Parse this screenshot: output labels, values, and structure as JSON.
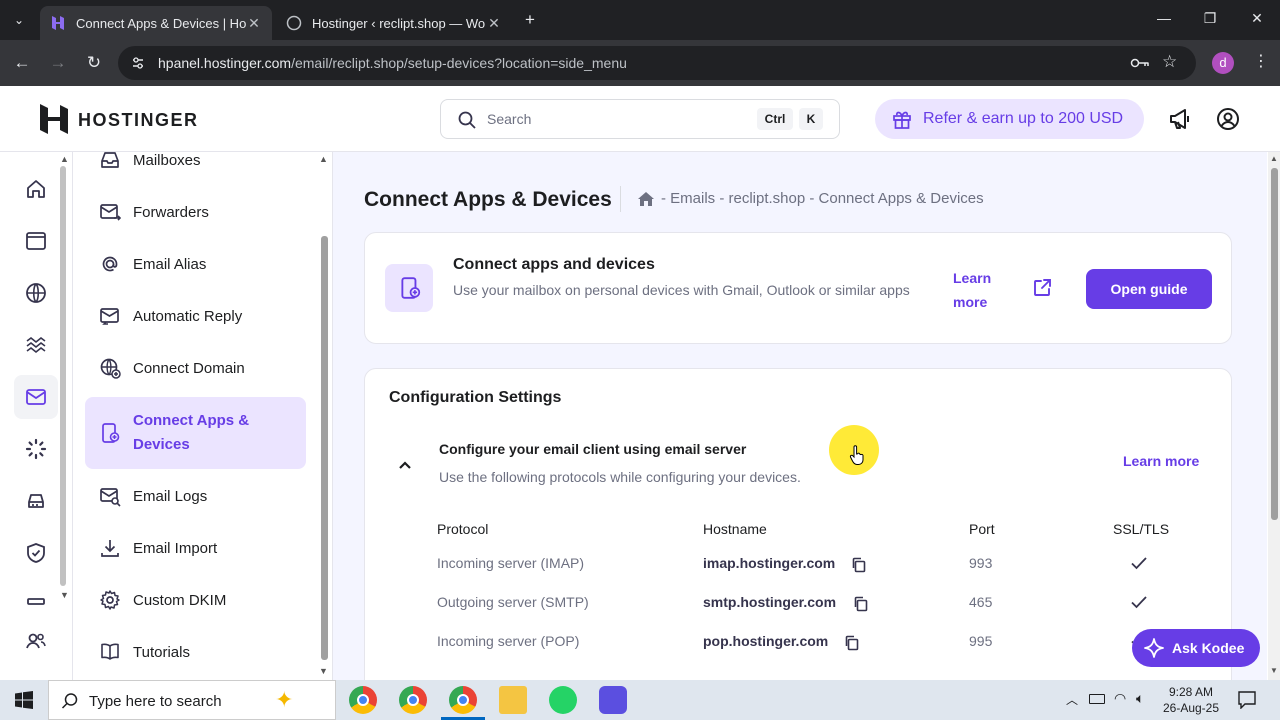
{
  "browser": {
    "tabs": [
      {
        "title": "Connect Apps & Devices | Hostinger",
        "active": true
      },
      {
        "title": "Hostinger ‹ reclipt.shop — WordPress",
        "active": false
      }
    ],
    "url_domain": "hpanel.hostinger.com",
    "url_path": "/email/reclipt.shop/setup-devices?location=side_menu",
    "profile_initial": "d"
  },
  "header": {
    "logo": "HOSTINGER",
    "search_placeholder": "Search",
    "shortcut_ctrl": "Ctrl",
    "shortcut_k": "K",
    "refer_label": "Refer & earn up to 200 USD"
  },
  "sidebar": {
    "items": [
      {
        "label": "Mailboxes",
        "icon": "inbox-icon"
      },
      {
        "label": "Forwarders",
        "icon": "forward-mail-icon"
      },
      {
        "label": "Email Alias",
        "icon": "at-icon"
      },
      {
        "label": "Automatic Reply",
        "icon": "auto-reply-icon"
      },
      {
        "label": "Connect Domain",
        "icon": "globe-plus-icon"
      },
      {
        "label": "Connect Apps & Devices",
        "icon": "device-plus-icon",
        "active": true
      },
      {
        "label": "Email Logs",
        "icon": "mail-search-icon"
      },
      {
        "label": "Email Import",
        "icon": "download-icon"
      },
      {
        "label": "Custom DKIM",
        "icon": "gear-icon"
      },
      {
        "label": "Tutorials",
        "icon": "book-icon"
      }
    ]
  },
  "main": {
    "title": "Connect Apps & Devices",
    "breadcrumb": "- Emails - reclipt.shop - Connect Apps & Devices",
    "guide_card": {
      "title": "Connect apps and devices",
      "description": "Use your mailbox on personal devices with Gmail, Outlook or similar apps",
      "learn_more": "Learn more",
      "open_guide": "Open guide"
    },
    "config": {
      "title": "Configuration Settings",
      "subtitle": "Configure your email client using email server",
      "subtitle_desc": "Use the following protocols while configuring your devices.",
      "learn_more": "Learn more",
      "columns": [
        "Protocol",
        "Hostname",
        "Port",
        "SSL/TLS"
      ],
      "rows": [
        {
          "protocol": "Incoming server (IMAP)",
          "hostname": "imap.hostinger.com",
          "port": "993",
          "ssl": true
        },
        {
          "protocol": "Outgoing server (SMTP)",
          "hostname": "smtp.hostinger.com",
          "port": "465",
          "ssl": true
        },
        {
          "protocol": "Incoming server (POP)",
          "hostname": "pop.hostinger.com",
          "port": "995",
          "ssl": true
        }
      ]
    }
  },
  "assistant": {
    "label": "Ask Kodee"
  },
  "taskbar": {
    "search_placeholder": "Type here to search",
    "time": "9:28 AM",
    "date": "26-Aug-25"
  },
  "colors": {
    "accent": "#673de6",
    "accent_light": "#ebe4ff",
    "bg": "#f4f5ff"
  }
}
